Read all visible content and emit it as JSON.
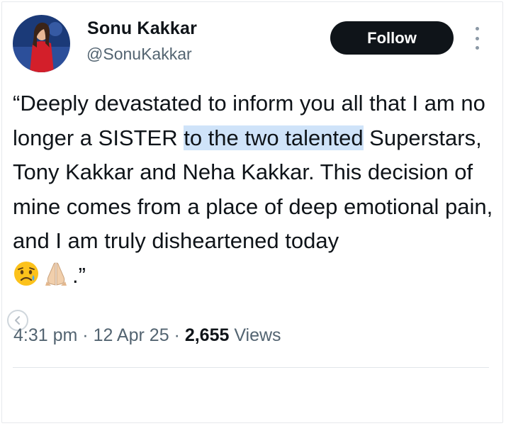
{
  "author": {
    "name": "Sonu Kakkar",
    "handle": "@SonuKakkar"
  },
  "actions": {
    "follow_label": "Follow"
  },
  "tweet": {
    "part1": "“Deeply devastated to inform you all that I am no longer a SISTER ",
    "highlight": "to the two talented",
    "part2": " Superstars, Tony Kakkar and Neha Kakkar. This decision of mine comes from a place of deep emotional pain, and I am truly disheartened today ",
    "emojis": [
      "sad-face-emoji",
      "folded-hands-emoji"
    ],
    "closing": ".”"
  },
  "meta": {
    "time": "4:31 pm",
    "sep1": " · ",
    "date": "12 Apr 25",
    "sep2": " · ",
    "views_count": "2,655",
    "views_label": " Views"
  },
  "colors": {
    "text": "#0f1419",
    "secondary": "#536471",
    "highlight": "#cfe3f9",
    "button_bg": "#0f1419"
  },
  "icons": [
    "more-options-icon",
    "chevron-left-icon"
  ]
}
